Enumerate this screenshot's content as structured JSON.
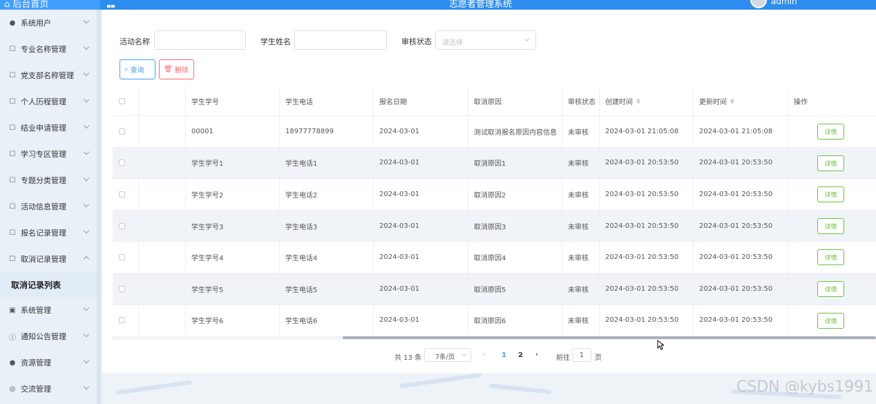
{
  "header": {
    "home_label": "后台首页",
    "site_title": "志愿者管理系统",
    "username": "admin"
  },
  "sidebar": {
    "items": [
      {
        "label": "系统用户",
        "icon": "user-icon",
        "expanded": false
      },
      {
        "label": "专业名称管理",
        "icon": "folder-icon",
        "expanded": false
      },
      {
        "label": "党支部名称管理",
        "icon": "folder-icon",
        "expanded": false
      },
      {
        "label": "个人历程管理",
        "icon": "folder-icon",
        "expanded": false
      },
      {
        "label": "结业申请管理",
        "icon": "folder-icon",
        "expanded": false
      },
      {
        "label": "学习专区管理",
        "icon": "folder-icon",
        "expanded": false
      },
      {
        "label": "专题分类管理",
        "icon": "folder-icon",
        "expanded": false
      },
      {
        "label": "活动信息管理",
        "icon": "folder-icon",
        "expanded": false
      },
      {
        "label": "报名记录管理",
        "icon": "folder-icon",
        "expanded": false
      },
      {
        "label": "取消记录管理",
        "icon": "folder-icon",
        "expanded": true
      }
    ],
    "active_sub": "取消记录列表",
    "items_after": [
      {
        "label": "系统管理",
        "icon": "image-icon"
      },
      {
        "label": "通知公告管理",
        "icon": "info-icon"
      },
      {
        "label": "资源管理",
        "icon": "location-icon"
      },
      {
        "label": "交流管理",
        "icon": "chat-icon"
      }
    ]
  },
  "filters": {
    "activity_label": "活动名称",
    "activity_value": "",
    "student_label": "学生姓名",
    "student_value": "",
    "status_label": "审核状态",
    "status_placeholder": "请选择"
  },
  "actions": {
    "search_label": "查询",
    "delete_label": "删除"
  },
  "table": {
    "headers": {
      "no": "学生学号",
      "tel": "学生电话",
      "date": "报名日期",
      "reason": "取消原因",
      "status": "审核状态",
      "created": "创建时间",
      "updated": "更新时间",
      "op": "操作"
    },
    "detail_label": "详情",
    "rows": [
      {
        "no": "00001",
        "tel": "18977778899",
        "date": "2024-03-01",
        "reason": "测试取消报名原因内容信息",
        "status": "未审核",
        "created": "2024-03-01 21:05:08",
        "updated": "2024-03-01 21:05:08"
      },
      {
        "no": "学生学号1",
        "tel": "学生电话1",
        "date": "2024-03-01",
        "reason": "取消原因1",
        "status": "未审核",
        "created": "2024-03-01 20:53:50",
        "updated": "2024-03-01 20:53:50"
      },
      {
        "no": "学生学号2",
        "tel": "学生电话2",
        "date": "2024-03-01",
        "reason": "取消原因2",
        "status": "未审核",
        "created": "2024-03-01 20:53:50",
        "updated": "2024-03-01 20:53:50"
      },
      {
        "no": "学生学号3",
        "tel": "学生电话3",
        "date": "2024-03-01",
        "reason": "取消原因3",
        "status": "未审核",
        "created": "2024-03-01 20:53:50",
        "updated": "2024-03-01 20:53:50"
      },
      {
        "no": "学生学号4",
        "tel": "学生电话4",
        "date": "2024-03-01",
        "reason": "取消原因4",
        "status": "未审核",
        "created": "2024-03-01 20:53:50",
        "updated": "2024-03-01 20:53:50"
      },
      {
        "no": "学生学号5",
        "tel": "学生电话5",
        "date": "2024-03-01",
        "reason": "取消原因5",
        "status": "未审核",
        "created": "2024-03-01 20:53:50",
        "updated": "2024-03-01 20:53:50"
      },
      {
        "no": "学生学号6",
        "tel": "学生电话6",
        "date": "2024-03-01",
        "reason": "取消原因6",
        "status": "未审核",
        "created": "2024-03-01 20:53:50",
        "updated": "2024-03-01 20:53:50"
      }
    ]
  },
  "pagination": {
    "total": "共 13 条",
    "page_size": "7条/页",
    "pages": [
      "1",
      "2"
    ],
    "current": "1",
    "goto_label": "前往",
    "goto_value": "1",
    "page_word": "页"
  },
  "watermark": "CSDN @kybs1991",
  "colors": {
    "primary": "#409eff",
    "danger": "#f56c6c",
    "success": "#67c23a",
    "header": "#2d8cf0"
  }
}
